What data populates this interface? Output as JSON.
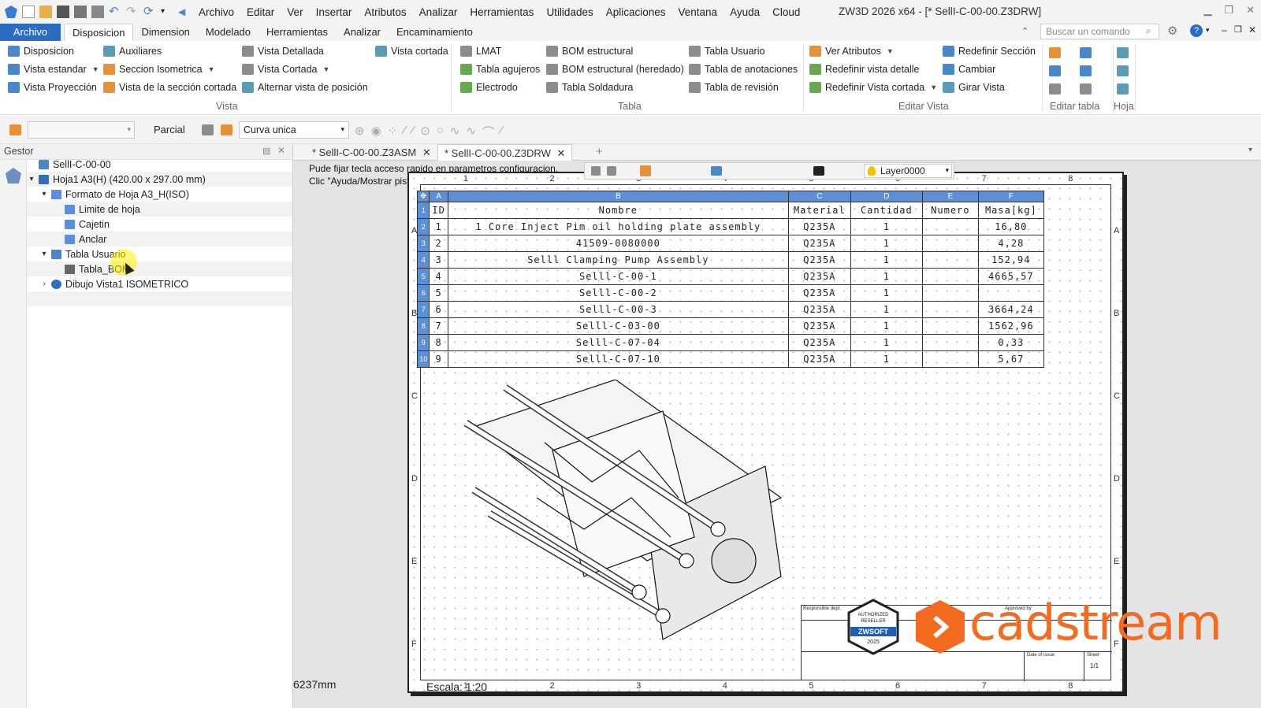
{
  "titlebar": {
    "menu": [
      "Archivo",
      "Editar",
      "Ver",
      "Insertar",
      "Atributos",
      "Analizar",
      "Herramientas",
      "Utilidades",
      "Aplicaciones",
      "Ventana",
      "Ayuda",
      "Cloud"
    ],
    "window_title": "ZW3D 2026 x64 - [* SellI-C-00-00.Z3DRW]"
  },
  "ribbon_tabs": {
    "file": "Archivo",
    "tabs": [
      "Disposicion",
      "Dimension",
      "Modelado",
      "Herramientas",
      "Analizar",
      "Encaminamiento"
    ],
    "active": "Disposicion",
    "search_placeholder": "Buscar un comando"
  },
  "ribbon": {
    "vista": {
      "label": "Vista",
      "disposicion": "Disposicion",
      "auxiliares": "Auxiliares",
      "vista_detallada": "Vista Detallada",
      "vista_cortada_top": "Vista cortada",
      "vista_estandar": "Vista estandar",
      "seccion_isometrica": "Seccion Isometrica",
      "vista_cortada": "Vista Cortada",
      "vista_proyeccion": "Vista Proyección",
      "vista_seccion_cortada": "Vista de la sección cortada",
      "alternar_vista": "Alternar vista de posición"
    },
    "tabla": {
      "label": "Tabla",
      "lmat": "LMAT",
      "tabla_agujeros": "Tabla agujeros",
      "electrodo": "Electrodo",
      "bom_estructural": "BOM estructural",
      "bom_heredado": "BOM estructural (heredado)",
      "tabla_soldadura": "Tabla Soldadura",
      "tabla_usuario": "Tabla Usuario",
      "tabla_anotaciones": "Tabla de anotaciones",
      "tabla_revision": "Tabla de revisión"
    },
    "editar_vista": {
      "label": "Editar Vista",
      "ver_atributos": "Ver Atributos",
      "redefinir_detalle": "Redefinir vista detalle",
      "redefinir_cortada": "Redefinir Vista cortada",
      "redefinir_seccion": "Redefinir Sección",
      "cambiar": "Cambiar",
      "girar_vista": "Girar Vista"
    },
    "editar_tabla_label": "Editar tabla",
    "hoja_label": "Hoja"
  },
  "toolbar2": {
    "filter_label": "Parcial",
    "curve_select": "Curva unica"
  },
  "manager": {
    "title": "Gestor",
    "tree": [
      {
        "label": "SellI-C-00-00"
      },
      {
        "label": "Hoja1 A3(H) (420.00 x 297.00 mm)"
      },
      {
        "label": "Formato de Hoja A3_H(ISO)"
      },
      {
        "label": "Limite de hoja"
      },
      {
        "label": "Cajetin"
      },
      {
        "label": "Anclar"
      },
      {
        "label": "Tabla Usuario"
      },
      {
        "label": "Tabla_BOM"
      },
      {
        "label": "Dibujo Vista1 ISOMETRICO"
      }
    ]
  },
  "doc_tabs": [
    "* SellI-C-00-00.Z3ASM",
    "* SellI-C-00-00.Z3DRW"
  ],
  "hints": {
    "line1": "Pude fijar tecla acceso rapido en parametros configuracion.",
    "line2": "Clic \"Ayuda/Mostrar pistas\" para deshabilitar estas pistas."
  },
  "layer": "Layer0000",
  "bom": {
    "col_letters": [
      "A",
      "B",
      "C",
      "D",
      "E",
      "F"
    ],
    "headers": [
      "ID",
      "Nombre",
      "Material",
      "Cantidad",
      "Numero",
      "Masa[kg]"
    ],
    "rows": [
      [
        "1",
        "1 Core Inject Pim oil holding plate assembly",
        "Q235A",
        "1",
        "",
        "16,80"
      ],
      [
        "2",
        "41509-0080000",
        "Q235A",
        "1",
        "",
        "4,28"
      ],
      [
        "3",
        "Selll Clamping Pump Assembly",
        "Q235A",
        "1",
        "",
        "152,94"
      ],
      [
        "4",
        "Selll-C-00-1",
        "Q235A",
        "1",
        "",
        "4665,57"
      ],
      [
        "5",
        "Selll-C-00-2",
        "Q235A",
        "1",
        "",
        ""
      ],
      [
        "6",
        "Selll-C-00-3",
        "Q235A",
        "1",
        "",
        "3664,24"
      ],
      [
        "7",
        "Selll-C-03-00",
        "Q235A",
        "1",
        "",
        "1562,96"
      ],
      [
        "8",
        "Selll-C-07-04",
        "Q235A",
        "1",
        "",
        "0,33"
      ],
      [
        "9",
        "Selll-C-07-10",
        "Q235A",
        "1",
        "",
        "5,67"
      ]
    ]
  },
  "zones": {
    "cols": [
      "1",
      "2",
      "3",
      "4",
      "5",
      "6",
      "7",
      "8"
    ],
    "rows": [
      "A",
      "B",
      "C",
      "D",
      "E",
      "F"
    ]
  },
  "titleblock": {
    "responsible": "Responsible dept.",
    "approved": "Approved by",
    "date_of_issue": "Date of issue",
    "sheet": "Sheet",
    "sheet_value": "1/1"
  },
  "badge": {
    "line1": "AUTHORIZED",
    "line2": "RESELLER",
    "brand": "ZWSOFT",
    "year": "2025"
  },
  "logo_text": "cadstream",
  "status": {
    "coord": "6237mm",
    "scale": "Escala: 1:20"
  },
  "colors": {
    "accent": "#2b6cc4",
    "table_header": "#5b8fd8",
    "logo_orange": "#f26b21"
  }
}
